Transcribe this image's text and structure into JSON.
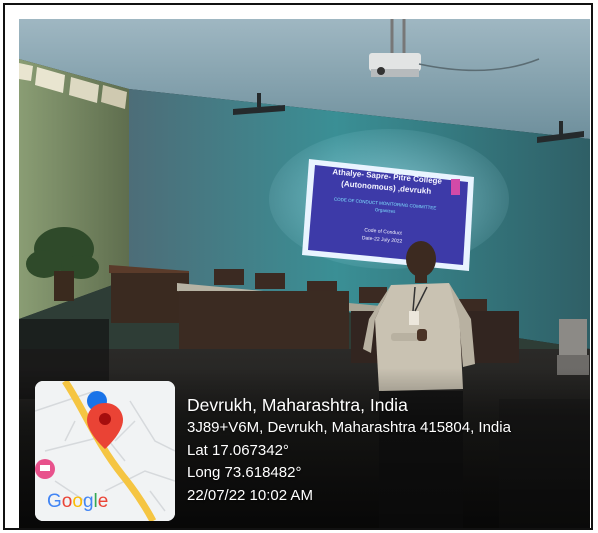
{
  "projector_slide": {
    "title_line1": "Athalye- Sapre- Pitre College",
    "title_line2": "(Autonomous) ,devrukh",
    "subtitle_line1": "CODE OF CONDUCT MONITORING COMMITTEE",
    "subtitle_line2": "Organizes",
    "body_line1": "Code of Conduct",
    "body_line2": "Date-22 July 2022"
  },
  "geotag": {
    "city": "Devrukh, Maharashtra, India",
    "address": "3J89+V6M, Devrukh, Maharashtra 415804, India",
    "latitude": "Lat 17.067342°",
    "longitude": "Long 73.618482°",
    "datetime": "22/07/22 10:02 AM"
  },
  "map": {
    "logo_text": "Google",
    "logo_colors": [
      "#4285F4",
      "#EA4335",
      "#FBBC05",
      "#4285F4",
      "#34A853",
      "#EA4335"
    ],
    "pin_color": "#EA4335",
    "hotel_marker_color": "#E8528C",
    "location_dot_color": "#1A73E8",
    "road_color": "#F5C542"
  }
}
